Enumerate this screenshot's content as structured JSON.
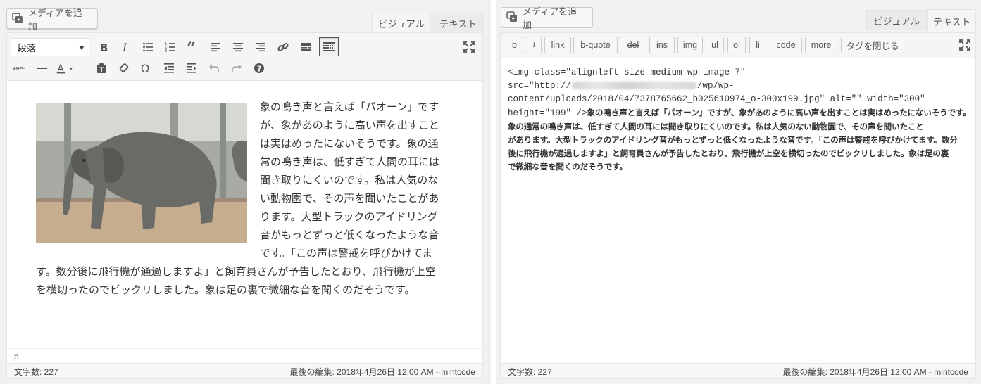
{
  "left": {
    "media_button": "メディアを追加",
    "tabs": {
      "visual": "ビジュアル",
      "text": "テキスト"
    },
    "format_select": "段落",
    "content_text": "象の鳴き声と言えば「パオーン」ですが、象があのように高い声を出すことは実はめったにないそうです。象の通常の鳴き声は、低すぎて人間の耳には聞き取りにくいのです。私は人気のない動物園で、その声を聞いたことがあります。大型トラックのアイドリング音がもっとずっと低くなったような音です。「この声は警戒を呼びかけてます。数分後に飛行機が通過しますよ」と飼育員さんが予告したとおり、飛行機が上空を横切ったのでビックリしました。象は足の裏で微細な音を聞くのだそうです。",
    "path": "p",
    "word_count": "文字数: 227",
    "last_edit": "最後の編集: 2018年4月26日 12:00 AM - mintcode",
    "icons": [
      "bold-icon",
      "italic-icon",
      "bullet-list-icon",
      "numbered-list-icon",
      "blockquote-icon",
      "align-left-icon",
      "align-center-icon",
      "align-right-icon",
      "link-icon",
      "read-more-icon",
      "toolbar-toggle-icon",
      "fullscreen-icon",
      "strikethrough-icon",
      "horizontal-line-icon",
      "text-color-icon",
      "paste-as-text-icon",
      "clear-formatting-icon",
      "special-character-icon",
      "outdent-icon",
      "indent-icon",
      "undo-icon",
      "redo-icon",
      "help-icon"
    ]
  },
  "right": {
    "media_button": "メディアを追加",
    "tabs": {
      "visual": "ビジュアル",
      "text": "テキスト"
    },
    "quicktags": [
      "b",
      "i",
      "link",
      "b-quote",
      "del",
      "ins",
      "img",
      "ul",
      "ol",
      "li",
      "code",
      "more",
      "タグを閉じる"
    ],
    "code": {
      "line1": "<img class=\"alignleft size-medium wp-image-7\"",
      "line2_pre": "src=\"http://",
      "line2_post": "/wp/wp-",
      "line3": "content/uploads/2018/04/7378765662_b025610974_o-300x199.jpg\" alt=\"\" width=\"300\"",
      "line4_pre": "height=\"199\" />",
      "line4_jp": "象の鳴き声と言えば「パオーン」ですが、象があのように高い声を出すことは実はめったにないそうです。",
      "line5": "象の通常の鳴き声は、低すぎて人間の耳には聞き取りにくいのです。私は人気のない動物園で、その声を聞いたこと",
      "line6": "があります。大型トラックのアイドリング音がもっとずっと低くなったような音です。「この声は警戒を呼びかけてます。数分",
      "line7": "後に飛行機が通過しますよ」と飼育員さんが予告したとおり、飛行機が上空を横切ったのでビックリしました。象は足の裏",
      "line8": "で微細な音を聞くのだそうです。"
    },
    "word_count": "文字数: 227",
    "last_edit": "最後の編集: 2018年4月26日 12:00 AM - mintcode"
  },
  "colors": {
    "background": "#f1f1f1",
    "toolbar": "#f5f5f5",
    "editor": "#ffffff",
    "border": "#e5e5e5",
    "text": "#333333"
  }
}
